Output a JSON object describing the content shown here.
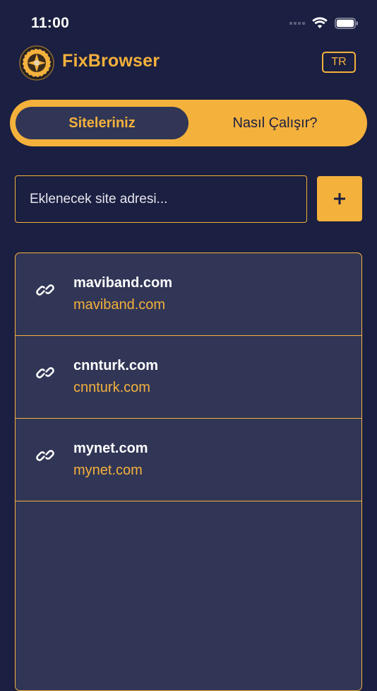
{
  "status_bar": {
    "time": "11:00"
  },
  "header": {
    "app_name": "FixBrowser",
    "language": "TR"
  },
  "tabs": {
    "active": "Siteleriniz",
    "inactive": "Nasıl Çalışır?"
  },
  "add_site": {
    "placeholder": "Eklenecek site adresi...",
    "button_label": "+"
  },
  "sites": [
    {
      "name": "maviband.com",
      "url": "maviband.com"
    },
    {
      "name": "cnnturk.com",
      "url": "cnnturk.com"
    },
    {
      "name": "mynet.com",
      "url": "mynet.com"
    }
  ],
  "colors": {
    "background": "#1b1f41",
    "accent": "#f4b13c",
    "card": "#313656"
  }
}
